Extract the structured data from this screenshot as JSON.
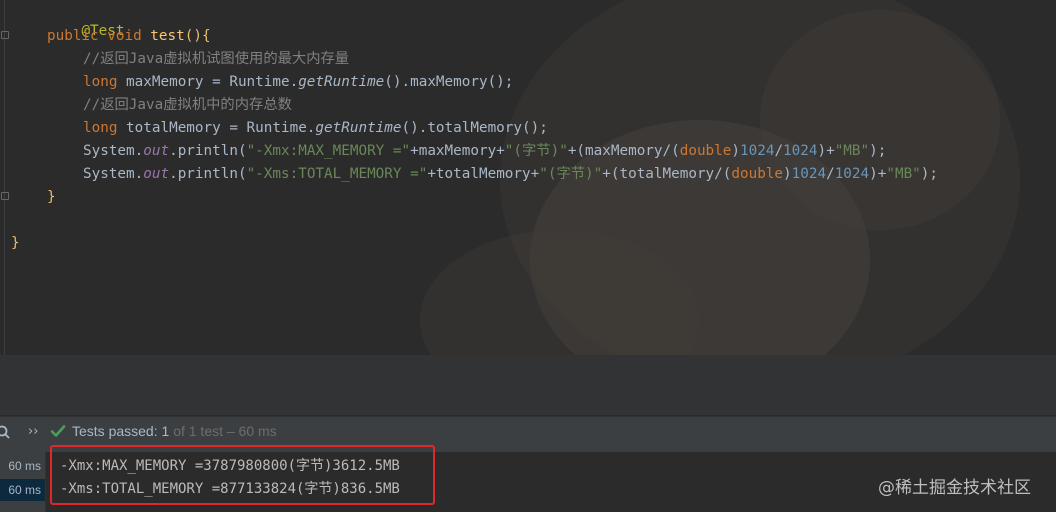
{
  "editor": {
    "annotation": "@Test",
    "method_modifiers": "public void",
    "method_name": "test",
    "method_parens": "(){",
    "comment1": "//返回Java虚拟机试图使用的最大内存量",
    "line2_type": "long",
    "line2_var": " maxMemory = Runtime.",
    "line2_call": "getRuntime",
    "line2_rest": "().maxMemory();",
    "comment2": "//返回Java虚拟机中的内存总数",
    "line3_type": "long",
    "line3_var": " totalMemory = Runtime.",
    "line3_call": "getRuntime",
    "line3_rest": "().totalMemory();",
    "print1_prefix": "System.",
    "print1_out": "out",
    "print1_println": ".println(",
    "print1_str1": "\"-Xmx:MAX_MEMORY =\"",
    "print1_mid1": "+maxMemory+",
    "print1_str2": "\"(字节)\"",
    "print1_mid2": "+(maxMemory/(",
    "print1_cast": "double",
    "print1_mid3": ")",
    "print1_num1": "1024",
    "print1_slash": "/",
    "print1_num2": "1024",
    "print1_mid4": ")+",
    "print1_str3": "\"MB\"",
    "print1_end": ");",
    "print2_prefix": "System.",
    "print2_out": "out",
    "print2_println": ".println(",
    "print2_str1": "\"-Xms:TOTAL_MEMORY =\"",
    "print2_mid1": "+totalMemory+",
    "print2_str2": "\"(字节)\"",
    "print2_mid2": "+(totalMemory/(",
    "print2_cast": "double",
    "print2_mid3": ")",
    "print2_num1": "1024",
    "print2_slash": "/",
    "print2_num2": "1024",
    "print2_mid4": ")+",
    "print2_str3": "\"MB\"",
    "print2_end": ");",
    "method_close": "}",
    "class_close": "}"
  },
  "run_panel": {
    "status_label": "Tests passed:",
    "passed_count": "1",
    "status_detail": "of 1 test – 60 ms",
    "tree_rows": [
      "60 ms",
      "60 ms"
    ]
  },
  "console": {
    "line1": "-Xmx:MAX_MEMORY =3787980800(字节)3612.5MB",
    "line2": "-Xms:TOTAL_MEMORY =877133824(字节)836.5MB"
  },
  "watermark": "@稀土掘金技术社区",
  "colors": {
    "highlight_box": "#e0282b",
    "pass_check": "#4aa05a"
  }
}
